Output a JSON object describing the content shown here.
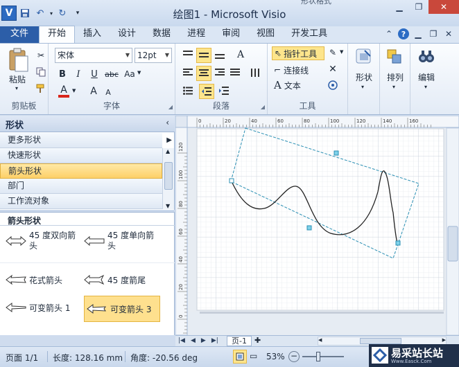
{
  "window": {
    "title": "绘图1 - Microsoft Visio",
    "partial_title_above": "形状格式"
  },
  "qat": {
    "logo": "V"
  },
  "tabs": [
    "文件",
    "开始",
    "插入",
    "设计",
    "数据",
    "进程",
    "审阅",
    "视图",
    "开发工具"
  ],
  "active_tab": "开始",
  "ribbon": {
    "clipboard": {
      "label": "剪贴板",
      "paste": "粘贴"
    },
    "font": {
      "label": "字体",
      "font_name": "宋体",
      "font_size": "12pt",
      "bold": "B",
      "italic": "I",
      "underline": "U",
      "strike": "abc",
      "case": "Aa",
      "color_letter": "A",
      "grow": "A",
      "shrink": "A"
    },
    "paragraph": {
      "label": "段落"
    },
    "tools": {
      "label": "工具",
      "pointer": "指针工具",
      "connector": "连接线",
      "text": "文本",
      "text_letter": "A"
    },
    "shape": {
      "label": "形状"
    },
    "arrange": {
      "label": "排列"
    },
    "edit": {
      "label": "编辑"
    }
  },
  "shapes_panel": {
    "title": "形状",
    "categories": [
      "更多形状",
      "快速形状",
      "箭头形状",
      "部门",
      "工作流对象"
    ],
    "selected_category": "箭头形状",
    "stencil_title": "箭头形状",
    "items": [
      {
        "label": "45 度双向箭头",
        "icon": "double-arrow-icon"
      },
      {
        "label": "45 度单向箭头",
        "icon": "single-arrow-icon"
      },
      {
        "label": "花式箭头",
        "icon": "fancy-arrow-icon"
      },
      {
        "label": "45 度箭尾",
        "icon": "arrow-tail-icon"
      },
      {
        "label": "可变箭头 1",
        "icon": "variable-arrow-icon"
      },
      {
        "label": "可变箭头 3",
        "icon": "variable-arrow-3-icon",
        "selected": true
      }
    ]
  },
  "ruler": {
    "h_labels": [
      "0",
      "20",
      "40",
      "60",
      "80",
      "100",
      "120",
      "140",
      "160"
    ],
    "v_labels": [
      "120",
      "100",
      "80",
      "60",
      "40",
      "20",
      "0"
    ]
  },
  "pages": {
    "current": "页-1"
  },
  "status": {
    "page": "页面 1/1",
    "length": "长度: 128.16 mm",
    "angle": "角度: -20.56 deg",
    "zoom": "53%"
  },
  "watermark": {
    "name": "易采站长站",
    "url": "Www.Easck.Com"
  },
  "colors": {
    "accent": "#2c5ea8",
    "selection": "#fde58c",
    "connector_dash": "#2a8fb3"
  }
}
